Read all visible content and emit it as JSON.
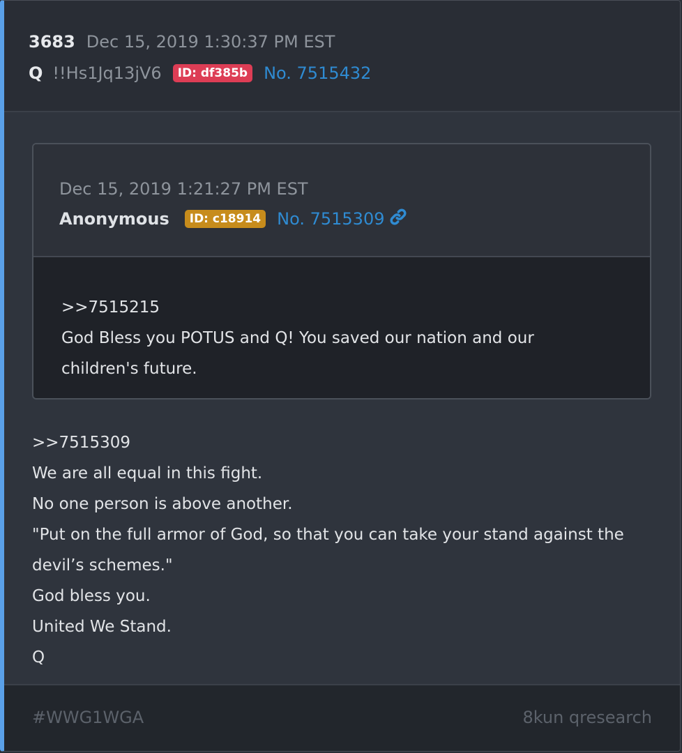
{
  "post": {
    "number": "3683",
    "date": "Dec 15, 2019 1:30:37 PM EST",
    "author": "Q",
    "tripcode": "!!Hs1Jq13jV6",
    "id_badge": "ID: df385b",
    "post_no": "No. 7515432",
    "body_lines": [
      ">>7515309",
      "We are all equal in this fight.",
      "No one person is above another.",
      "\"Put on the full armor of God, so that you can take your stand against the",
      "devil’s schemes.\"",
      "God bless you.",
      "United We Stand.",
      "Q"
    ]
  },
  "quote": {
    "date": "Dec 15, 2019 1:21:27 PM EST",
    "author": "Anonymous",
    "id_badge": "ID: c18914",
    "post_no": "No. 7515309",
    "link_icon": "link-icon",
    "body_lines": [
      ">>7515215",
      "God Bless you POTUS and Q! You saved our nation and our",
      "children's future."
    ]
  },
  "footer": {
    "tag": "#WWG1WGA",
    "source": "8kun qresearch"
  },
  "colors": {
    "accent_bar": "#5aa0e8",
    "id_badge_red": "#dd3d55",
    "id_badge_gold": "#c78c1c",
    "link": "#2f8bd2"
  }
}
